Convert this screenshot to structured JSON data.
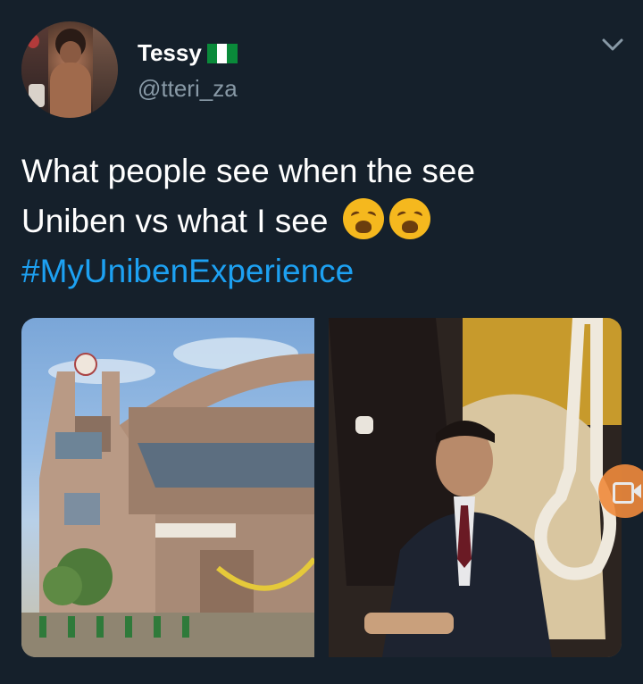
{
  "user": {
    "display_name": "Tessy",
    "handle": "@tteri_za",
    "flag_icon": "nigeria-flag-icon"
  },
  "tweet": {
    "line1": "What people see when the see",
    "line2": "Uniben vs what I see",
    "emoji_icon": "weary-face-emoji",
    "hashtag": "#MyUnibenExperience"
  },
  "media": {
    "left_image": "university-gate-photo",
    "right_image": "man-in-suit-with-noose-photo"
  },
  "colors": {
    "background": "#15202b",
    "text": "#ffffff",
    "secondary": "#8899a6",
    "link": "#1da1f2",
    "video_button": "#f08a3c"
  }
}
